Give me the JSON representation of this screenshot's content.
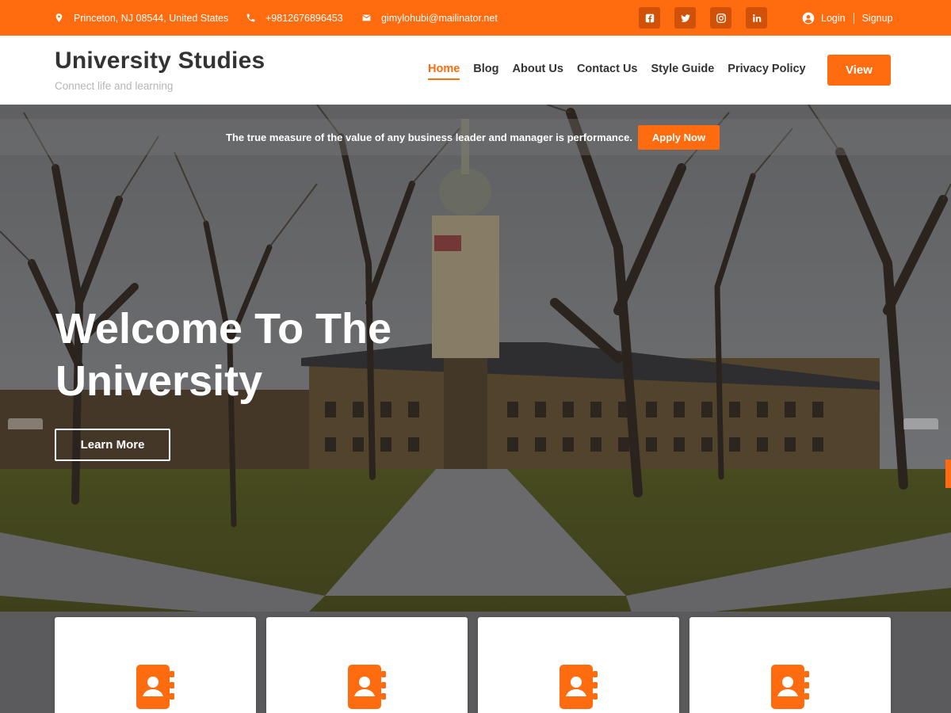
{
  "topbar": {
    "address": "Princeton, NJ 08544, United States",
    "phone": "+9812676896453",
    "email": "gimylohubi@mailinator.net",
    "social": [
      "facebook-icon",
      "twitter-icon",
      "instagram-icon",
      "linkedin-icon"
    ],
    "login_label": "Login",
    "signup_label": "Signup"
  },
  "header": {
    "site_title": "University Studies",
    "tagline": "Connect life and learning",
    "nav": [
      {
        "label": "Home",
        "active": true
      },
      {
        "label": "Blog",
        "active": false
      },
      {
        "label": "About Us",
        "active": false
      },
      {
        "label": "Contact Us",
        "active": false
      },
      {
        "label": "Style Guide",
        "active": false
      },
      {
        "label": "Privacy Policy",
        "active": false
      }
    ],
    "view_button": "View"
  },
  "hero": {
    "announcement": "The true measure of the value of any business leader and manager is performance.",
    "apply_button": "Apply Now",
    "title_line1": "Welcome To The",
    "title_line2": "University",
    "learn_more_button": "Learn More"
  },
  "cards": [
    {
      "icon": "contact-book-icon"
    },
    {
      "icon": "contact-book-icon"
    },
    {
      "icon": "contact-book-icon"
    },
    {
      "icon": "contact-book-icon"
    }
  ],
  "colors": {
    "accent": "#ff6b0f",
    "social_bg": "#cf5208",
    "title_text": "#333333",
    "tagline_text": "#b5b5b5"
  }
}
